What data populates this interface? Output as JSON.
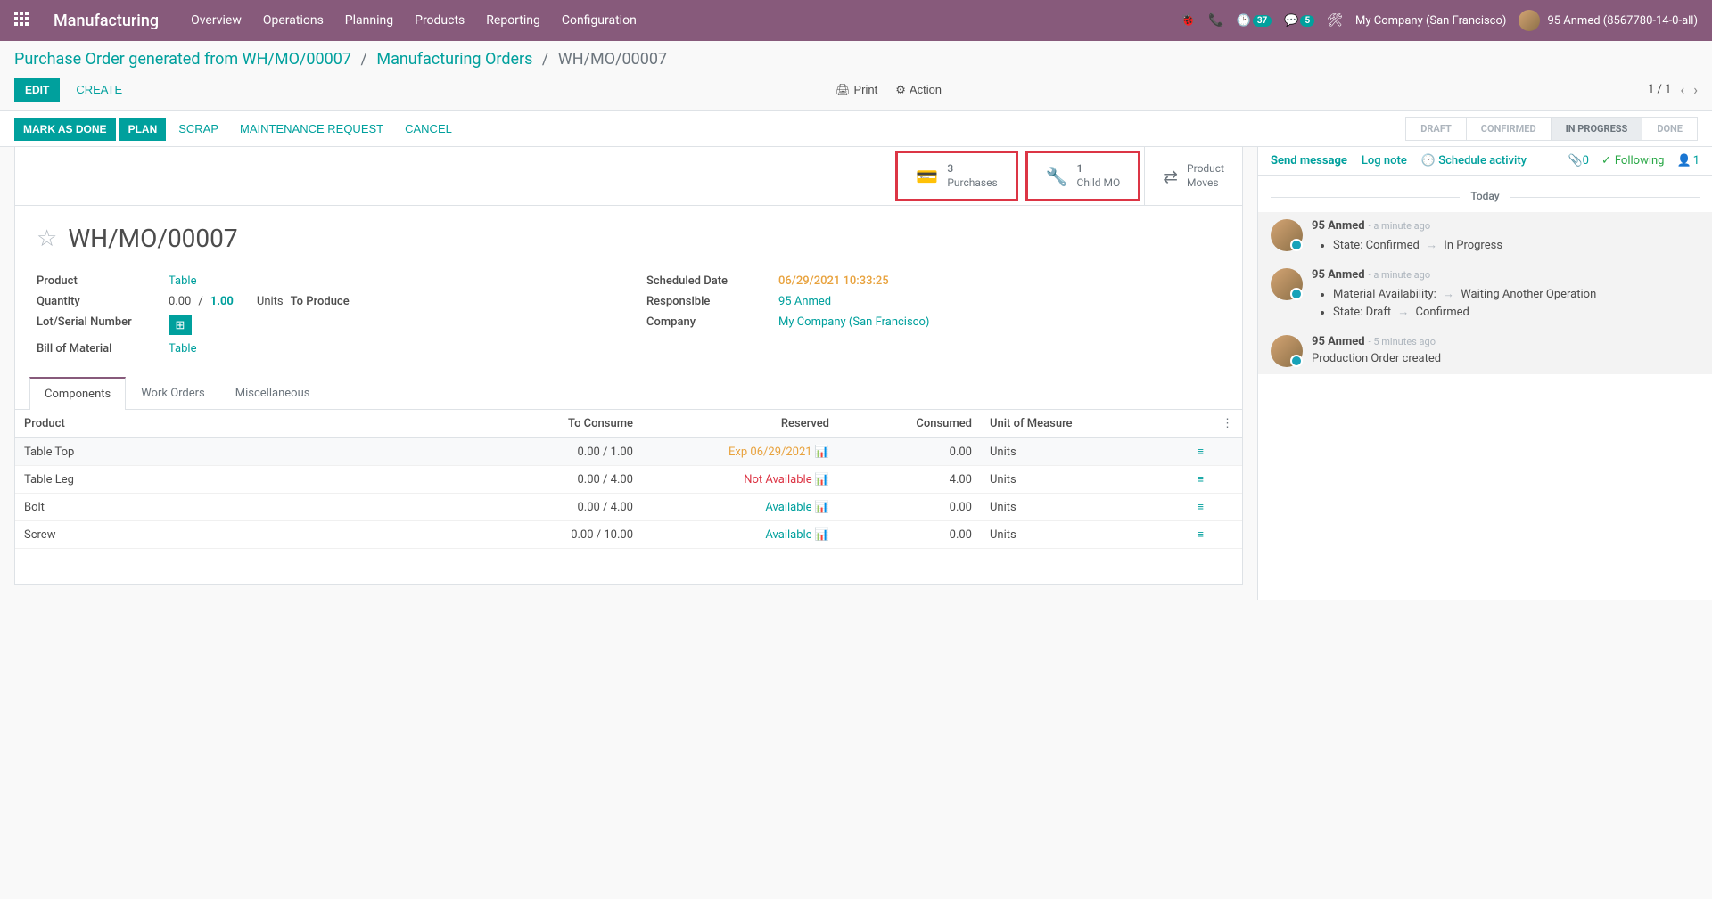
{
  "topnav": {
    "brand": "Manufacturing",
    "menu": [
      "Overview",
      "Operations",
      "Planning",
      "Products",
      "Reporting",
      "Configuration"
    ],
    "timer_badge": "37",
    "chat_badge": "5",
    "company": "My Company (San Francisco)",
    "user": "95 Anmed (8567780-14-0-all)"
  },
  "breadcrumb": {
    "items": [
      {
        "label": "Purchase Order generated from WH/MO/00007",
        "link": true
      },
      {
        "label": "Manufacturing Orders",
        "link": true
      },
      {
        "label": "WH/MO/00007",
        "link": false
      }
    ]
  },
  "actionbar": {
    "edit": "EDIT",
    "create": "CREATE",
    "print": "Print",
    "action": "Action",
    "pager": "1 / 1"
  },
  "statusbar": {
    "mark_done": "MARK AS DONE",
    "plan": "PLAN",
    "scrap": "SCRAP",
    "maint": "MAINTENANCE REQUEST",
    "cancel": "CANCEL",
    "steps": [
      {
        "label": "DRAFT",
        "active": false
      },
      {
        "label": "CONFIRMED",
        "active": false
      },
      {
        "label": "IN PROGRESS",
        "active": true
      },
      {
        "label": "DONE",
        "active": false
      }
    ]
  },
  "stat_buttons": {
    "purchases": {
      "count": "3",
      "label": "Purchases"
    },
    "child_mo": {
      "count": "1",
      "label": "Child MO"
    },
    "product_moves": {
      "line1": "Product",
      "line2": "Moves"
    }
  },
  "record": {
    "name": "WH/MO/00007",
    "fields_left": {
      "product_label": "Product",
      "product_value": "Table",
      "qty_label": "Quantity",
      "qty_done": "0.00",
      "qty_sep": "/",
      "qty_total": "1.00",
      "qty_uom": "Units",
      "qty_status": "To Produce",
      "lot_label": "Lot/Serial Number",
      "bom_label": "Bill of Material",
      "bom_value": "Table"
    },
    "fields_right": {
      "sched_label": "Scheduled Date",
      "sched_value": "06/29/2021 10:33:25",
      "resp_label": "Responsible",
      "resp_value": "95 Anmed",
      "company_label": "Company",
      "company_value": "My Company (San Francisco)"
    }
  },
  "tabs": [
    "Components",
    "Work Orders",
    "Miscellaneous"
  ],
  "components": {
    "headers": {
      "product": "Product",
      "to_consume": "To Consume",
      "reserved": "Reserved",
      "consumed": "Consumed",
      "uom": "Unit of Measure"
    },
    "rows": [
      {
        "product": "Table Top",
        "to_consume": "0.00 / 1.00",
        "reserved": "Exp 06/29/2021",
        "reserved_class": "warn",
        "consumed": "0.00",
        "uom": "Units"
      },
      {
        "product": "Table Leg",
        "to_consume": "0.00 / 4.00",
        "reserved": "Not Available",
        "reserved_class": "err",
        "consumed": "4.00",
        "uom": "Units"
      },
      {
        "product": "Bolt",
        "to_consume": "0.00 / 4.00",
        "reserved": "Available",
        "reserved_class": "ok",
        "consumed": "0.00",
        "uom": "Units"
      },
      {
        "product": "Screw",
        "to_consume": "0.00 / 10.00",
        "reserved": "Available",
        "reserved_class": "ok",
        "consumed": "0.00",
        "uom": "Units"
      }
    ]
  },
  "chatter": {
    "send": "Send message",
    "lognote": "Log note",
    "schedule": "Schedule activity",
    "attach_count": "0",
    "following": "Following",
    "follower_count": "1",
    "today": "Today",
    "messages": [
      {
        "author": "95 Anmed",
        "time": "- a minute ago",
        "items": [
          {
            "field": "State:",
            "old": "Confirmed",
            "new": "In Progress"
          }
        ]
      },
      {
        "author": "95 Anmed",
        "time": "- a minute ago",
        "items": [
          {
            "field": "Material Availability:",
            "old": "",
            "new": "Waiting Another Operation"
          },
          {
            "field": "State:",
            "old": "Draft",
            "new": "Confirmed"
          }
        ]
      },
      {
        "author": "95 Anmed",
        "time": "- 5 minutes ago",
        "plain": "Production Order created"
      }
    ]
  }
}
